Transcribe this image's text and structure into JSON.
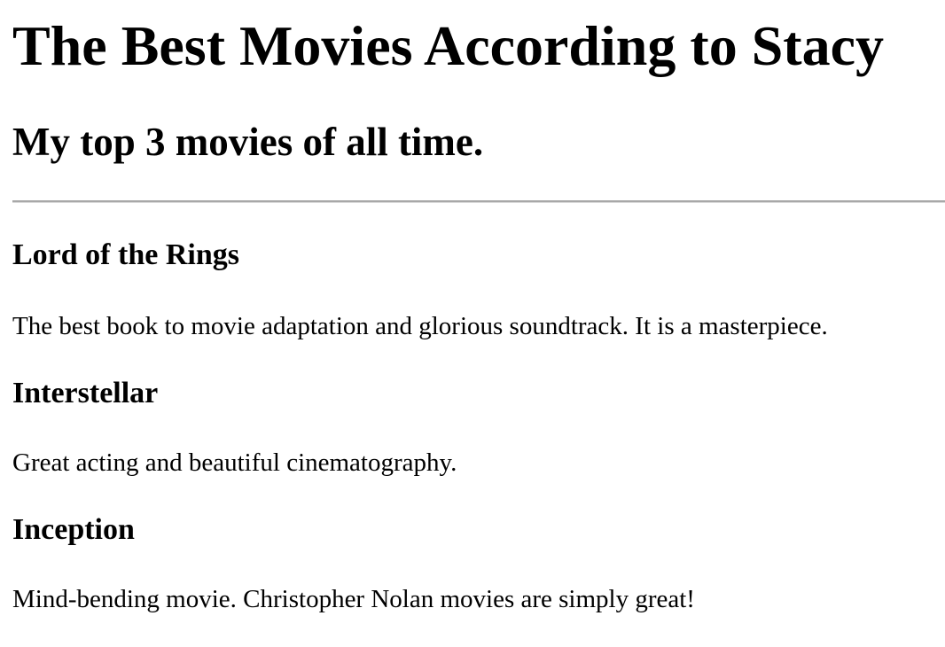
{
  "header": {
    "title": "The Best Movies According to Stacy",
    "subtitle": "My top 3 movies of all time."
  },
  "movies": [
    {
      "title": "Lord of the Rings",
      "description": "The best book to movie adaptation and glorious soundtrack. It is a masterpiece."
    },
    {
      "title": "Interstellar",
      "description": "Great acting and beautiful cinematography."
    },
    {
      "title": "Inception",
      "description": "Mind-bending movie. Christopher Nolan movies are simply great!"
    }
  ]
}
